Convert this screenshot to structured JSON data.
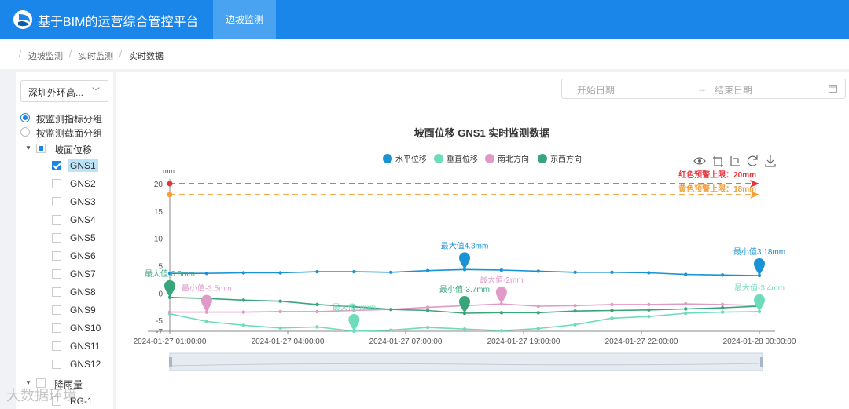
{
  "app": {
    "title": "基于BIM的运营综合管控平台",
    "nav_tab": "边坡监测"
  },
  "breadcrumb": [
    "边坡监测",
    "实时监测",
    "实时数据"
  ],
  "sidebar": {
    "select_value": "深圳外环高...",
    "radio": [
      {
        "label": "按监测指标分组",
        "checked": true
      },
      {
        "label": "按监测截面分组",
        "checked": false
      }
    ],
    "group1": {
      "label": "坡面位移",
      "items": [
        "GNS1",
        "GNS2",
        "GNS3",
        "GNS4",
        "GNS5",
        "GNS6",
        "GNS7",
        "GNS8",
        "GNS9",
        "GNS10",
        "GNS11",
        "GNS12"
      ],
      "selected": "GNS1"
    },
    "group2": {
      "label": "降雨量",
      "items": [
        "RG-1"
      ]
    }
  },
  "date_range": {
    "start_placeholder": "开始日期",
    "arrow": "→",
    "end_placeholder": "结束日期"
  },
  "chart_data": {
    "type": "line",
    "title": "坡面位移 GNS1 实时监测数据",
    "ylabel": "mm",
    "yticks": [
      -7,
      -5,
      0,
      5,
      10,
      15,
      20
    ],
    "ylim": [
      -7,
      20
    ],
    "x_ticks": [
      "2024-01-27 01:00:00",
      "2024-01-27 04:00:00",
      "2024-01-27 07:00:00",
      "2024-01-27 19:00:00",
      "2024-01-27 22:00:00",
      "2024-01-28 00:00:00"
    ],
    "legend_position": "top",
    "series": [
      {
        "name": "水平位移",
        "color": "#1a93d5",
        "values": [
          3.6,
          3.6,
          3.7,
          3.7,
          3.9,
          3.9,
          3.8,
          4.1,
          4.3,
          4.2,
          4.0,
          3.8,
          3.8,
          3.7,
          3.4,
          3.3,
          3.2
        ]
      },
      {
        "name": "垂直位移",
        "color": "#6edcbb",
        "values": [
          -3.8,
          -5.2,
          -5.9,
          -6.4,
          -6.2,
          -7.0,
          -6.8,
          -6.3,
          -6.6,
          -6.9,
          -6.5,
          -5.8,
          -4.6,
          -4.3,
          -3.7,
          -3.5,
          -3.4
        ]
      },
      {
        "name": "南北方向",
        "color": "#e09ac8",
        "values": [
          -3.5,
          -3.5,
          -3.5,
          -3.4,
          -3.4,
          -3.2,
          -3.0,
          -2.6,
          -2.3,
          -2.0,
          -2.4,
          -2.3,
          -2.1,
          -2.1,
          -2.0,
          -2.1,
          -2.3
        ]
      },
      {
        "name": "东西方向",
        "color": "#3aa57b",
        "values": [
          -0.8,
          -1.0,
          -1.3,
          -1.5,
          -2.1,
          -2.5,
          -3.0,
          -3.2,
          -3.7,
          -3.6,
          -3.6,
          -3.3,
          -3.2,
          -3.1,
          -2.9,
          -2.7,
          -2.4
        ]
      }
    ],
    "markers": [
      {
        "label": "最大值-0.8mm",
        "series": 3,
        "index": 0
      },
      {
        "label": "最小值-3.5mm",
        "series": 2,
        "index": 1
      },
      {
        "label": "最大值4.3mm",
        "series": 0,
        "index": 8
      },
      {
        "label": "最大值-7mm",
        "series": 1,
        "index": 5
      },
      {
        "label": "最小值-3.7mm",
        "series": 3,
        "index": 8
      },
      {
        "label": "最大值-2mm",
        "series": 2,
        "index": 9
      },
      {
        "label": "最小值3.18mm",
        "series": 0,
        "index": 16
      },
      {
        "label": "最大值-3.4mm",
        "series": 1,
        "index": 16
      }
    ],
    "thresholds": [
      {
        "label": "红色预警上限：20mm",
        "value": 20,
        "color": "#e8333a"
      },
      {
        "label": "黄色预警上限：18mm",
        "value": 18,
        "color": "#f0a03c"
      }
    ],
    "toolbox_icons": [
      "eye-icon",
      "crop-icon",
      "crop-reset-icon",
      "refresh-icon",
      "download-icon"
    ]
  },
  "watermark": "大数据环境"
}
